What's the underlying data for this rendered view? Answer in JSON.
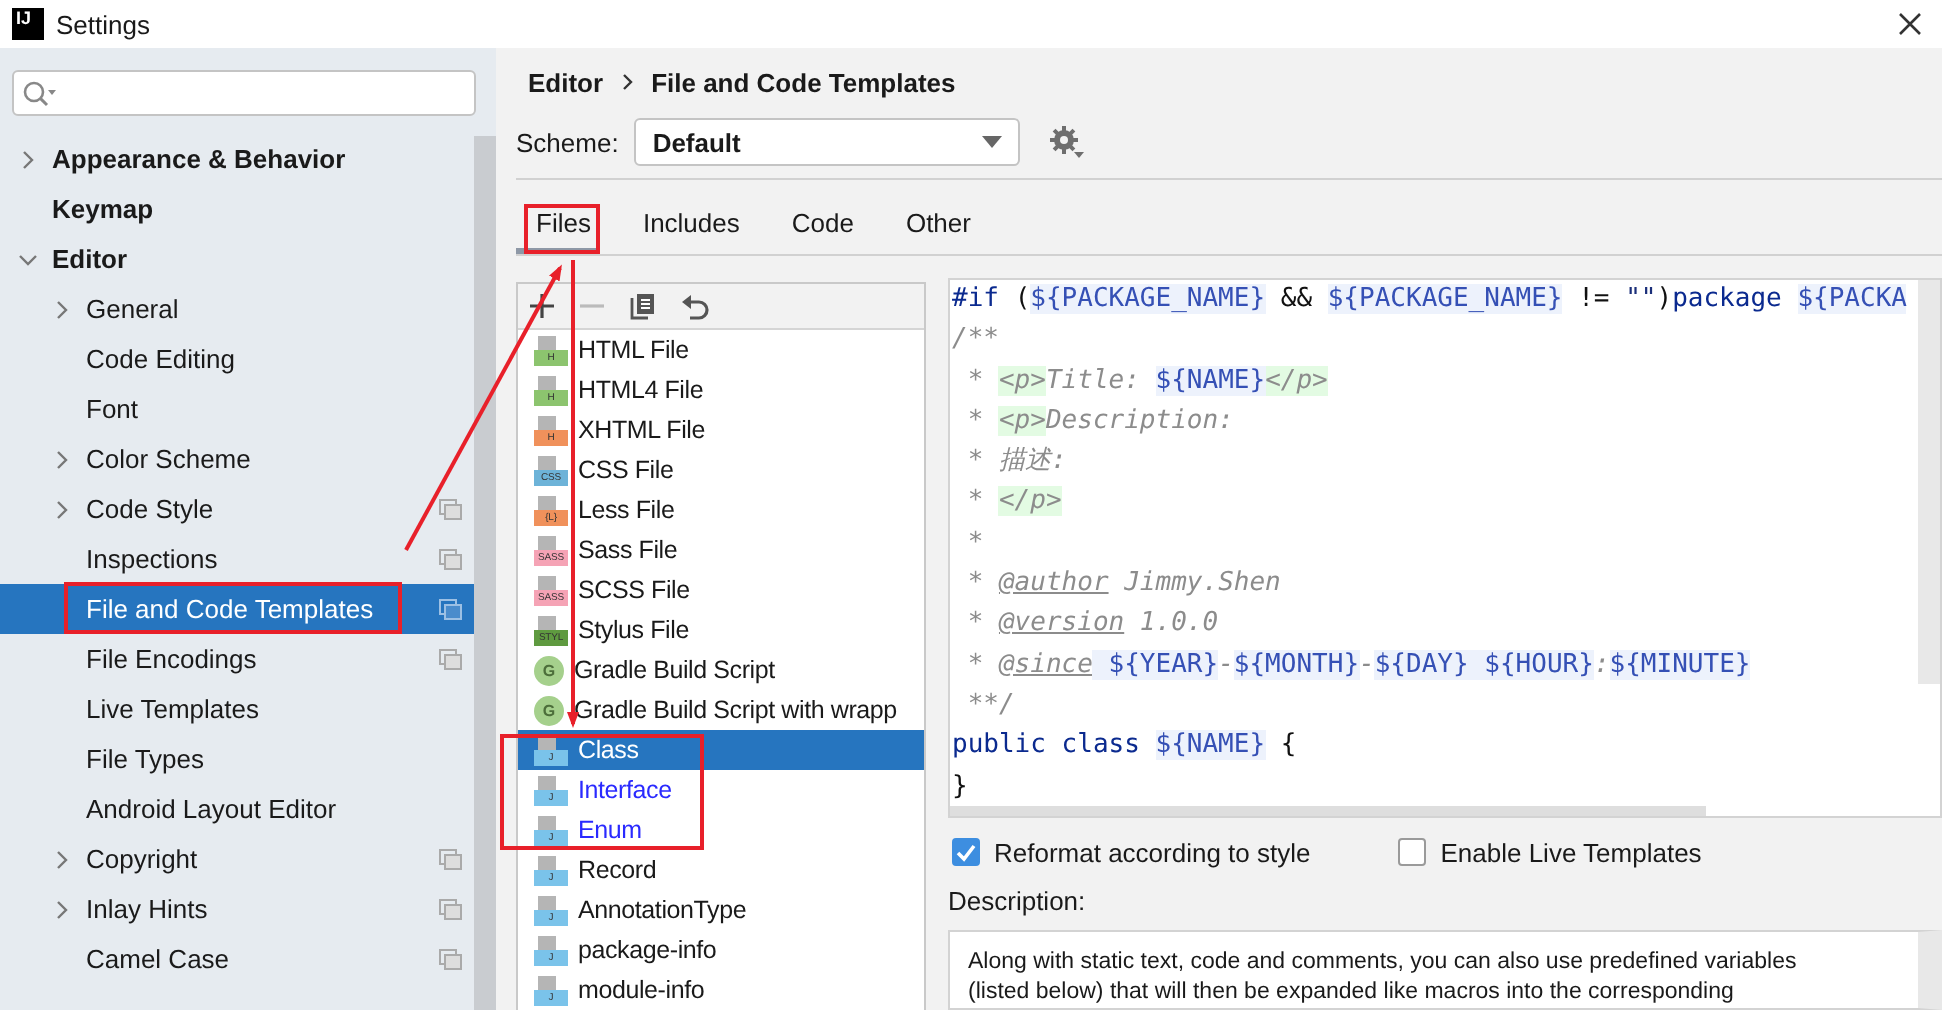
{
  "window": {
    "title": "Settings",
    "logo": "IJ"
  },
  "sidebar": {
    "items": [
      {
        "label": "Appearance & Behavior",
        "expanded": false,
        "selected": false,
        "scoped": false
      },
      {
        "label": "Keymap",
        "selected": false,
        "scoped": false
      },
      {
        "label": "Editor",
        "expanded": true,
        "selected": false,
        "scoped": false,
        "children": [
          {
            "label": "General",
            "expanded": false,
            "selected": false,
            "scoped": false
          },
          {
            "label": "Code Editing",
            "selected": false,
            "scoped": false
          },
          {
            "label": "Font",
            "selected": false,
            "scoped": false
          },
          {
            "label": "Color Scheme",
            "expanded": false,
            "selected": false,
            "scoped": false
          },
          {
            "label": "Code Style",
            "expanded": false,
            "selected": false,
            "scoped": true
          },
          {
            "label": "Inspections",
            "selected": false,
            "scoped": true
          },
          {
            "label": "File and Code Templates",
            "selected": true,
            "scoped": true
          },
          {
            "label": "File Encodings",
            "selected": false,
            "scoped": true
          },
          {
            "label": "Live Templates",
            "selected": false,
            "scoped": false
          },
          {
            "label": "File Types",
            "selected": false,
            "scoped": false
          },
          {
            "label": "Android Layout Editor",
            "selected": false,
            "scoped": false
          },
          {
            "label": "Copyright",
            "expanded": false,
            "selected": false,
            "scoped": true
          },
          {
            "label": "Inlay Hints",
            "expanded": false,
            "selected": false,
            "scoped": true
          },
          {
            "label": "Camel Case",
            "selected": false,
            "scoped": true
          }
        ]
      }
    ]
  },
  "breadcrumb": [
    "Editor",
    "File and Code Templates"
  ],
  "scheme": {
    "label": "Scheme:",
    "value": "Default"
  },
  "tabs": [
    {
      "label": "Files",
      "selected": true
    },
    {
      "label": "Includes",
      "selected": false
    },
    {
      "label": "Code",
      "selected": false
    },
    {
      "label": "Other",
      "selected": false
    }
  ],
  "templates": [
    {
      "label": "HTML File",
      "kind": "file",
      "badge": "H",
      "color": "#8cc46e",
      "selected": false,
      "modified": false
    },
    {
      "label": "HTML4 File",
      "kind": "file",
      "badge": "H",
      "color": "#8cc46e",
      "selected": false,
      "modified": false
    },
    {
      "label": "XHTML File",
      "kind": "file",
      "badge": "H",
      "color": "#f0915b",
      "selected": false,
      "modified": false
    },
    {
      "label": "CSS File",
      "kind": "file",
      "badge": "CSS",
      "color": "#6db3d8",
      "selected": false,
      "modified": false
    },
    {
      "label": "Less File",
      "kind": "file",
      "badge": "{L}",
      "color": "#f0915b",
      "selected": false,
      "modified": false
    },
    {
      "label": "Sass File",
      "kind": "file",
      "badge": "SASS",
      "color": "#f5a3b5",
      "selected": false,
      "modified": false
    },
    {
      "label": "SCSS File",
      "kind": "file",
      "badge": "SASS",
      "color": "#f5a3b5",
      "selected": false,
      "modified": false
    },
    {
      "label": "Stylus File",
      "kind": "file",
      "badge": "STYL",
      "color": "#5f9a40",
      "selected": false,
      "modified": false
    },
    {
      "label": "Gradle Build Script",
      "kind": "gradle",
      "badge": "G",
      "color": "#a5d08c",
      "selected": false,
      "modified": false
    },
    {
      "label": "Gradle Build Script with wrapp",
      "kind": "gradle",
      "badge": "G",
      "color": "#a5d08c",
      "selected": false,
      "modified": false
    },
    {
      "label": "Class",
      "kind": "file",
      "badge": "J",
      "color": "#7ac3ea",
      "selected": true,
      "modified": false
    },
    {
      "label": "Interface",
      "kind": "file",
      "badge": "J",
      "color": "#7ac3ea",
      "selected": false,
      "modified": true
    },
    {
      "label": "Enum",
      "kind": "file",
      "badge": "J",
      "color": "#7ac3ea",
      "selected": false,
      "modified": true
    },
    {
      "label": "Record",
      "kind": "file",
      "badge": "J",
      "color": "#7ac3ea",
      "selected": false,
      "modified": false
    },
    {
      "label": "AnnotationType",
      "kind": "file",
      "badge": "J",
      "color": "#7ac3ea",
      "selected": false,
      "modified": false
    },
    {
      "label": "package-info",
      "kind": "file",
      "badge": "J",
      "color": "#7ac3ea",
      "selected": false,
      "modified": false
    },
    {
      "label": "module-info",
      "kind": "file",
      "badge": "J",
      "color": "#7ac3ea",
      "selected": false,
      "modified": false
    }
  ],
  "code": [
    [
      {
        "kind": "kw",
        "text": "#if "
      },
      {
        "kind": "plain",
        "text": "("
      },
      {
        "kind": "var",
        "text": "${PACKAGE_NAME}"
      },
      {
        "kind": "plain",
        "text": " && "
      },
      {
        "kind": "var",
        "text": "${PACKAGE_NAME}"
      },
      {
        "kind": "plain",
        "text": " != "
      },
      {
        "kind": "str",
        "text": "\"\""
      },
      {
        "kind": "plain",
        "text": ")"
      },
      {
        "kind": "kw",
        "text": "package "
      },
      {
        "kind": "var",
        "text": "${PACKA"
      }
    ],
    [
      {
        "kind": "comment",
        "text": "/**"
      }
    ],
    [
      {
        "kind": "comment",
        "text": " * "
      },
      {
        "kind": "tag",
        "text": "<p>"
      },
      {
        "kind": "comment",
        "text": "Title: "
      },
      {
        "kind": "var",
        "text": "${NAME}"
      },
      {
        "kind": "tag",
        "text": "</p>"
      }
    ],
    [
      {
        "kind": "comment",
        "text": " * "
      },
      {
        "kind": "tag",
        "text": "<p>"
      },
      {
        "kind": "comment",
        "text": "Description:"
      }
    ],
    [
      {
        "kind": "comment",
        "text": " * 描述:"
      }
    ],
    [
      {
        "kind": "comment",
        "text": " * "
      },
      {
        "kind": "tag",
        "text": "</p>"
      }
    ],
    [
      {
        "kind": "comment",
        "text": " *"
      }
    ],
    [
      {
        "kind": "comment",
        "text": " * "
      },
      {
        "kind": "doctag",
        "text": "@author"
      },
      {
        "kind": "comment",
        "text": " Jimmy.Shen"
      }
    ],
    [
      {
        "kind": "comment",
        "text": " * "
      },
      {
        "kind": "doctag",
        "text": "@version"
      },
      {
        "kind": "comment",
        "text": " 1.0.0"
      }
    ],
    [
      {
        "kind": "comment",
        "text": " * "
      },
      {
        "kind": "doctag",
        "text": "@since"
      },
      {
        "kind": "var",
        "text": " ${YEAR}"
      },
      {
        "kind": "comment",
        "text": "-"
      },
      {
        "kind": "var",
        "text": "${MONTH}"
      },
      {
        "kind": "comment",
        "text": "-"
      },
      {
        "kind": "var",
        "text": "${DAY}"
      },
      {
        "kind": "var",
        "text": " ${HOUR}"
      },
      {
        "kind": "comment",
        "text": ":"
      },
      {
        "kind": "var",
        "text": "${MINUTE}"
      }
    ],
    [
      {
        "kind": "comment",
        "text": " **/"
      }
    ],
    [
      {
        "kind": "kw",
        "text": "public class "
      },
      {
        "kind": "var",
        "text": "${NAME}"
      },
      {
        "kind": "plain",
        "text": " {"
      }
    ],
    [
      {
        "kind": "plain",
        "text": "}"
      }
    ]
  ],
  "options": [
    {
      "label": "Reformat according to style",
      "checked": true
    },
    {
      "label": "Enable Live Templates",
      "checked": false
    }
  ],
  "description": {
    "label": "Description:",
    "lines": [
      "Along with static text, code and comments, you can also use predefined variables",
      "(listed below) that will then be expanded like macros into the corresponding"
    ]
  }
}
